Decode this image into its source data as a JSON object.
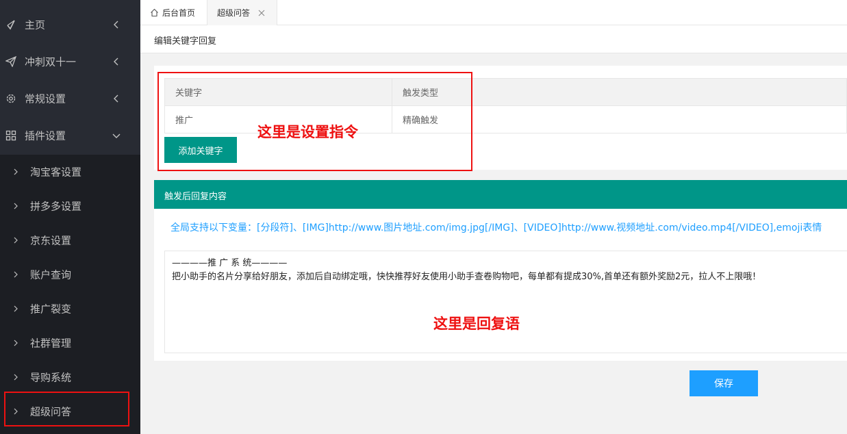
{
  "sidebar": {
    "top_items": [
      {
        "label": "主页",
        "icon": "send-check-icon"
      },
      {
        "label": "冲刺双十一",
        "icon": "paper-plane-icon"
      },
      {
        "label": "常规设置",
        "icon": "gear-icon"
      },
      {
        "label": "插件设置",
        "icon": "grid-icon"
      }
    ],
    "sub_items": [
      {
        "label": "淘宝客设置"
      },
      {
        "label": "拼多多设置"
      },
      {
        "label": "京东设置"
      },
      {
        "label": "账户查询"
      },
      {
        "label": "推广裂变"
      },
      {
        "label": "社群管理"
      },
      {
        "label": "导购系统"
      },
      {
        "label": "超级问答"
      }
    ]
  },
  "tabs": [
    {
      "label": "后台首页",
      "icon": "home-icon"
    },
    {
      "label": "超级问答",
      "icon": "close-icon"
    }
  ],
  "page_title": "编辑关键字回复",
  "keyword_table": {
    "headers": [
      "关键字",
      "触发类型"
    ],
    "rows": [
      [
        "推广",
        "精确触发"
      ]
    ]
  },
  "add_keyword_label": "添加关键字",
  "reply_section_title": "触发后回复内容",
  "variables_hint": "全局支持以下变量：[分段符]、[IMG]http://www.图片地址.com/img.jpg[/IMG]、[VIDEO]http://www.视频地址.com/video.mp4[/VIDEO],emoji表情",
  "reply_text_line1": "————推 广 系 统————",
  "reply_text_line2": "把小助手的名片分享给好朋友，添加后自动绑定哦，快快推荐好友使用小助手查卷购物吧，每单都有提成30%,首单还有额外奖励2元，拉人不上限哦！",
  "save_label": "保存",
  "annotations": {
    "command": "这里是设置指令",
    "reply": "这里是回复语"
  },
  "colors": {
    "sidebar_bg": "#282b33",
    "accent": "#009688",
    "blue": "#1e9fff",
    "highlight": "#e11111"
  }
}
